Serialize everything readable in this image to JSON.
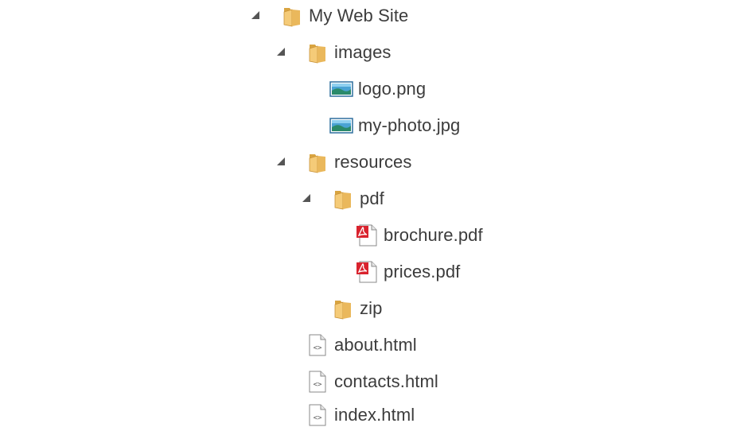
{
  "tree": {
    "root": {
      "label": "My Web Site",
      "icon": "folder-icon",
      "expanded": true
    },
    "images": {
      "label": "images",
      "icon": "folder-icon",
      "expanded": true
    },
    "logo": {
      "label": "logo.png",
      "icon": "image-file-icon"
    },
    "photo": {
      "label": "my-photo.jpg",
      "icon": "image-file-icon"
    },
    "resources": {
      "label": "resources",
      "icon": "folder-icon",
      "expanded": true
    },
    "pdf": {
      "label": "pdf",
      "icon": "folder-icon",
      "expanded": true
    },
    "brochure": {
      "label": "brochure.pdf",
      "icon": "pdf-file-icon"
    },
    "prices": {
      "label": "prices.pdf",
      "icon": "pdf-file-icon"
    },
    "zip": {
      "label": "zip",
      "icon": "folder-icon",
      "expanded": false
    },
    "about": {
      "label": "about.html",
      "icon": "html-file-icon"
    },
    "contacts": {
      "label": "contacts.html",
      "icon": "html-file-icon"
    },
    "index": {
      "label": "index.html",
      "icon": "html-file-icon"
    }
  },
  "colors": {
    "folder": "#f2c46d",
    "folder_dark": "#d9a441",
    "pdf_red": "#d9232e",
    "image_blue": "#2e7fb3",
    "text": "#3c3c3c",
    "expander": "#555555"
  }
}
